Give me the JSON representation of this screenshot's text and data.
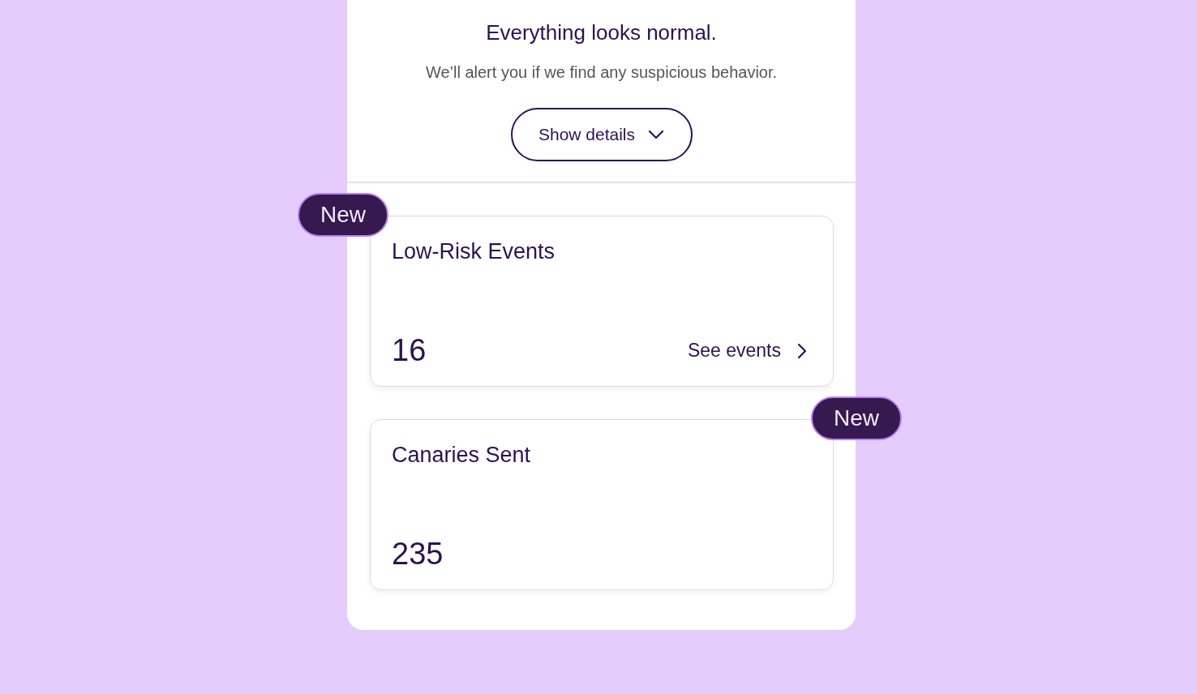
{
  "status": {
    "title": "Everything looks normal.",
    "message": "We’ll alert you if we find any suspicious behavior.",
    "details_button": {
      "label": "Show details",
      "expanded": false
    }
  },
  "cards": [
    {
      "title": "Low-Risk Events",
      "count": "16",
      "link": "See events",
      "badge": {
        "label": "New",
        "on_left": true
      }
    },
    {
      "title": "Canaries Sent",
      "count": "235",
      "badge": {
        "label": "New",
        "on_left": false
      }
    }
  ]
}
